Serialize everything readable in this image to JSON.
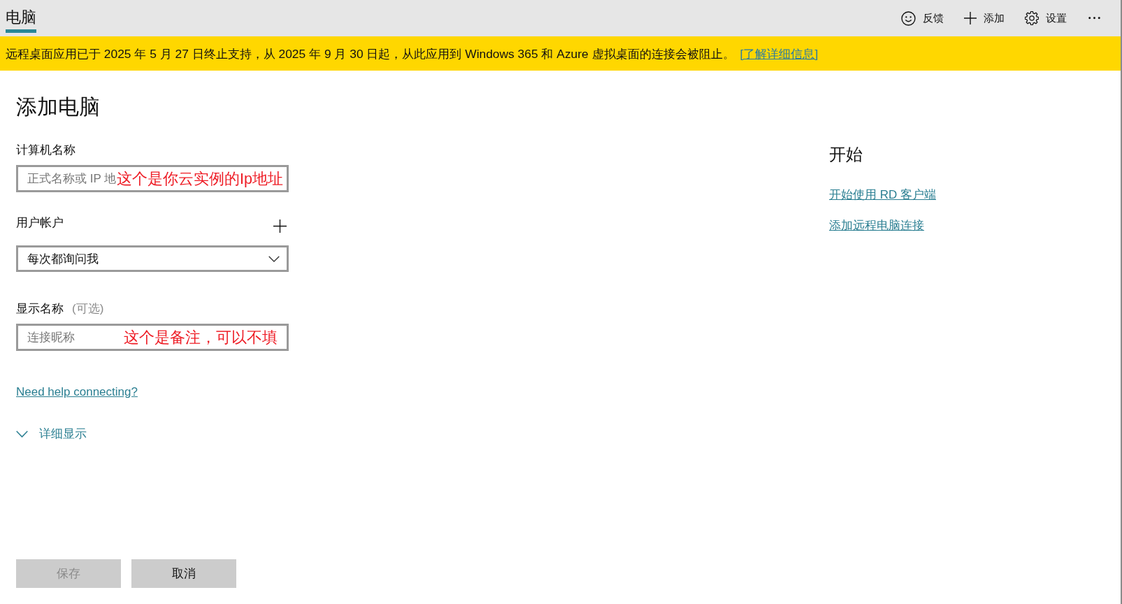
{
  "header": {
    "tabs": [
      {
        "label": "电脑",
        "selected": true
      }
    ],
    "actions": [
      {
        "kind": "feedback",
        "label": "反馈"
      },
      {
        "kind": "add",
        "label": "添加"
      },
      {
        "kind": "settings",
        "label": "设置"
      },
      {
        "kind": "more"
      }
    ]
  },
  "banner": {
    "text": "远程桌面应用已于 2025 年 5 月 27 日终止支持，从 2025 年 9 月 30 日起，从此应用到 Windows 365 和 Azure 虚拟桌面的连接会被阻止。",
    "link": "[了解详细信息]"
  },
  "form": {
    "title": "添加电脑",
    "fields": [
      {
        "kind": "text",
        "label": "计算机名称",
        "placeholder": "正式名称或 IP 地",
        "annotation": "这个是你云实例的Ip地址"
      },
      {
        "kind": "select",
        "label": "用户帐户",
        "value": "每次都询问我",
        "addable": true
      },
      {
        "kind": "text",
        "label": "显示名称",
        "hint": "(可选)",
        "placeholder": "连接昵称",
        "annotation": "这个是备注，可以不填"
      }
    ],
    "help_link": "Need help connecting?",
    "details_toggle": {
      "label": "详细显示",
      "expanded": false
    },
    "buttons": [
      {
        "label": "保存",
        "disabled": true
      },
      {
        "label": "取消",
        "disabled": false
      }
    ]
  },
  "sidebar": {
    "title": "开始",
    "links": [
      "开始使用 RD 客户端",
      "添加远程电脑连接"
    ]
  }
}
